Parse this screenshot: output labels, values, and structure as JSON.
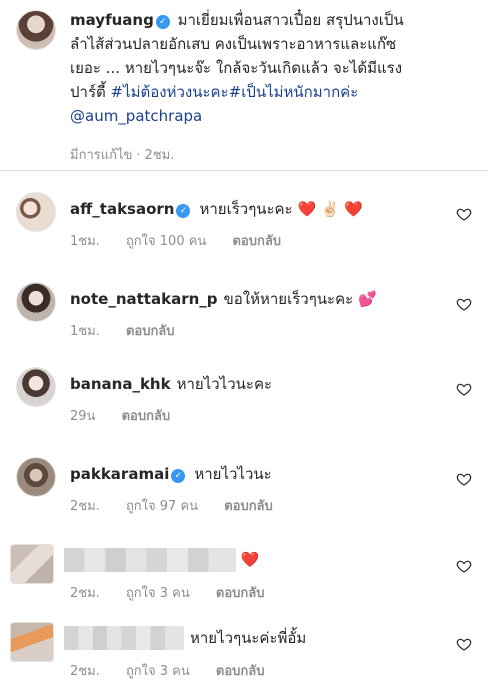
{
  "post": {
    "username": "mayfuang",
    "caption_lines": [
      "มาเยี่ยมเพื่อนสาวเปื๋อย สรุปนางเป็น",
      "ลำไส้ส่วนปลายอักเสบ คงเป็นเพราะอาหารและแก๊ซ",
      "เยอะ ... หายไวๆนะจ๊ะ ใกล้จะวันเกิดแล้ว จะได้มีแรง"
    ],
    "caption_line4_prefix": "ปาร์ตี้",
    "caption_hashtags": "#ไม่ต้องห่วงนะคะ#เป็นไม่หนักมากค่ะ",
    "mention": "@aum_patchrapa",
    "edited_label": "มีการแก้ไข",
    "time": "2ชม."
  },
  "comments": [
    {
      "username": "aff_taksaorn",
      "verified": true,
      "text": "หายเร็วๆนะคะ",
      "emoji": "❤️ ✌🏻 ❤️",
      "time": "1ชม.",
      "likes": "ถูกใจ 100 คน",
      "reply": "ตอบกลับ"
    },
    {
      "username": "note_nattakarn_p",
      "verified": false,
      "text": "ขอให้หายเร็วๆนะคะ",
      "emoji": "💕",
      "time": "1ชม.",
      "likes": "",
      "reply": "ตอบกลับ"
    },
    {
      "username": "banana_khk",
      "verified": false,
      "text": "หายไวไวนะคะ",
      "emoji": "",
      "time": "29น",
      "likes": "",
      "reply": "ตอบกลับ"
    },
    {
      "username": "pakkaramai",
      "verified": true,
      "text": "หายไวไวนะ",
      "emoji": "",
      "time": "2ชม.",
      "likes": "ถูกใจ 97 คน",
      "reply": "ตอบกลับ"
    },
    {
      "username": "",
      "verified": false,
      "text": "",
      "emoji": "❤️",
      "time": "2ชม.",
      "likes": "ถูกใจ 3 คน",
      "reply": "ตอบกลับ"
    },
    {
      "username": "",
      "verified": false,
      "text": "หายไวๆนะค่ะพี่อั้ม",
      "emoji": "",
      "time": "2ชม.",
      "likes": "ถูกใจ 3 คน",
      "reply": "ตอบกลับ"
    }
  ],
  "icons": {
    "verified": "verified-badge-icon",
    "like": "heart-outline-icon"
  },
  "colors": {
    "verified": "#3897f0",
    "hashtag": "#1b3f8f",
    "meta": "#8e8e8e"
  }
}
